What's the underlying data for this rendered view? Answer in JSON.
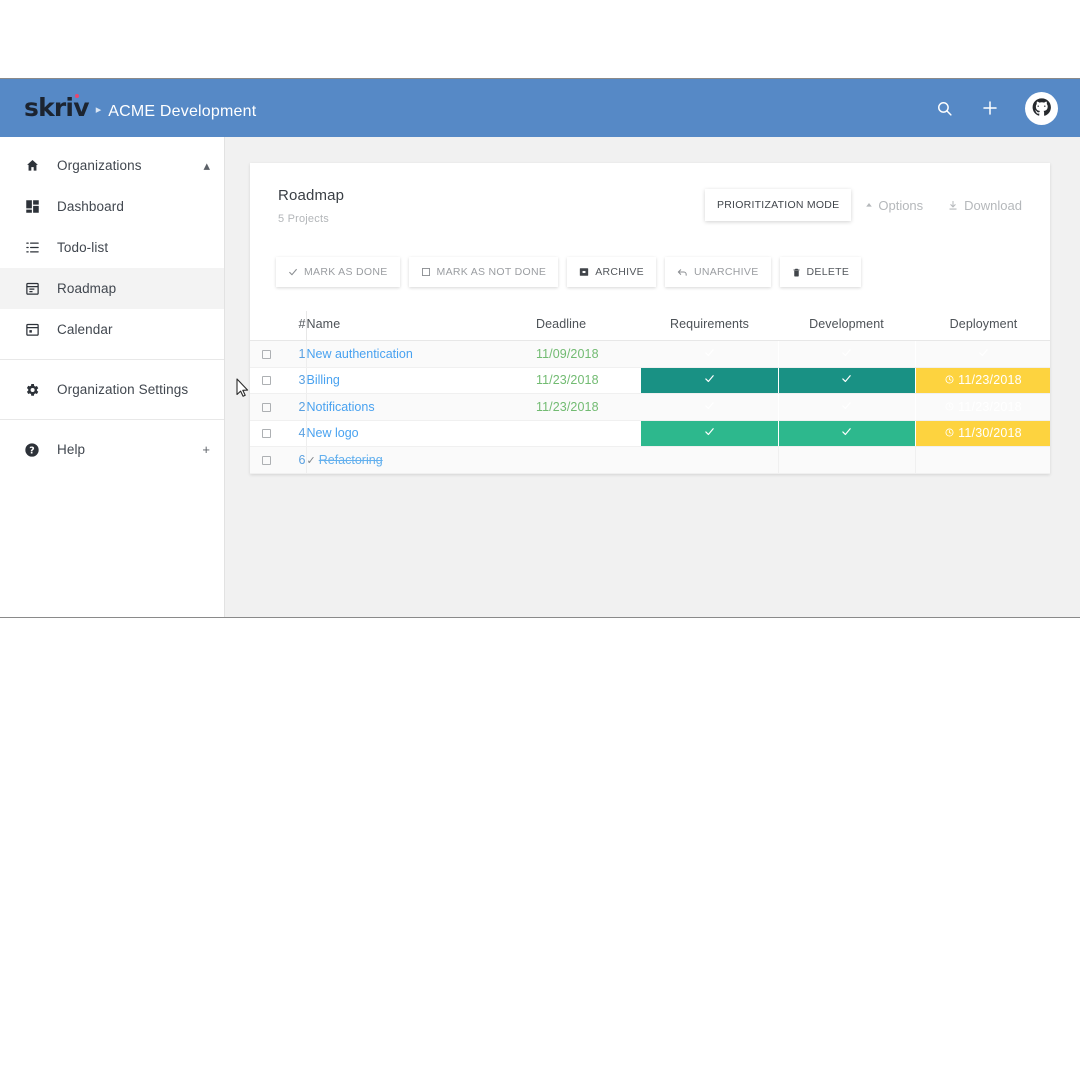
{
  "topbar": {
    "logo": "skriv",
    "separator": "▸",
    "org_name": "ACME Development",
    "search_icon": "search-icon",
    "add_icon": "plus-icon",
    "avatar_icon": "octocat-avatar",
    "bg_color": "#5689c6"
  },
  "sidebar": {
    "items": [
      {
        "label": "Organizations",
        "icon": "home-icon",
        "trailing": "▴",
        "active": false
      },
      {
        "label": "Dashboard",
        "icon": "dashboard-grid-icon",
        "trailing": "",
        "active": false
      },
      {
        "label": "Todo-list",
        "icon": "list-icon",
        "trailing": "",
        "active": false
      },
      {
        "label": "Roadmap",
        "icon": "calendar-lines-icon",
        "trailing": "",
        "active": true
      },
      {
        "label": "Calendar",
        "icon": "calendar-icon",
        "trailing": "",
        "active": false
      },
      {
        "label": "Organization Settings",
        "icon": "gear-icon",
        "trailing": "",
        "active": false
      },
      {
        "label": "Help",
        "icon": "help-circle-icon",
        "trailing": "+",
        "active": false
      }
    ]
  },
  "card": {
    "title": "Roadmap",
    "subtitle": "5 Projects",
    "prioritization_button": "PRIORITIZATION MODE",
    "options_button": "Options",
    "options_icon": "caret-up-icon",
    "download_button": "Download",
    "download_icon": "download-icon"
  },
  "toolbar": {
    "buttons": [
      {
        "label": "MARK AS DONE",
        "icon": "check-icon",
        "strong": false
      },
      {
        "label": "MARK AS NOT DONE",
        "icon": "empty-square-icon",
        "strong": false
      },
      {
        "label": "ARCHIVE",
        "icon": "archive-box-icon",
        "strong": true
      },
      {
        "label": "UNARCHIVE",
        "icon": "arrow-back-icon",
        "strong": false
      },
      {
        "label": "DELETE",
        "icon": "trash-icon",
        "strong": true
      }
    ]
  },
  "table": {
    "headers": {
      "num": "#",
      "name": "Name",
      "deadline": "Deadline",
      "stages": [
        "Requirements",
        "Development",
        "Deployment"
      ]
    },
    "rows": [
      {
        "num": "1",
        "name": "New authentication",
        "done": false,
        "deadline": "11/09/2018",
        "stages": [
          {
            "state": "green",
            "type": "check",
            "text": ""
          },
          {
            "state": "green",
            "type": "check",
            "text": ""
          },
          {
            "state": "green",
            "type": "check",
            "text": ""
          }
        ]
      },
      {
        "num": "3",
        "name": "Billing",
        "done": false,
        "deadline": "11/23/2018",
        "stages": [
          {
            "state": "green-dark",
            "type": "check",
            "text": ""
          },
          {
            "state": "green-dark",
            "type": "check",
            "text": ""
          },
          {
            "state": "yellow",
            "type": "date",
            "text": "11/23/2018"
          }
        ]
      },
      {
        "num": "2",
        "name": "Notifications",
        "done": false,
        "deadline": "11/23/2018",
        "stages": [
          {
            "state": "green-dark",
            "type": "check",
            "text": ""
          },
          {
            "state": "green",
            "type": "check",
            "text": ""
          },
          {
            "state": "yellow",
            "type": "date",
            "text": "11/23/2018"
          }
        ]
      },
      {
        "num": "4",
        "name": "New logo",
        "done": false,
        "deadline": "",
        "stages": [
          {
            "state": "green",
            "type": "check",
            "text": ""
          },
          {
            "state": "green",
            "type": "check",
            "text": ""
          },
          {
            "state": "yellow",
            "type": "date",
            "text": "11/30/2018"
          }
        ]
      },
      {
        "num": "6",
        "name": "Refactoring",
        "done": true,
        "deadline": "",
        "stages": [
          {
            "state": "empty",
            "type": "none",
            "text": ""
          },
          {
            "state": "empty",
            "type": "none",
            "text": ""
          },
          {
            "state": "empty",
            "type": "none",
            "text": ""
          }
        ]
      }
    ]
  },
  "colors": {
    "header_blue": "#5689c6",
    "stage_green": "#2db88d",
    "stage_green_dark": "#199184",
    "stage_yellow": "#fdd33f",
    "link_blue": "#49a2f0",
    "deadline_green": "#72bb72"
  }
}
